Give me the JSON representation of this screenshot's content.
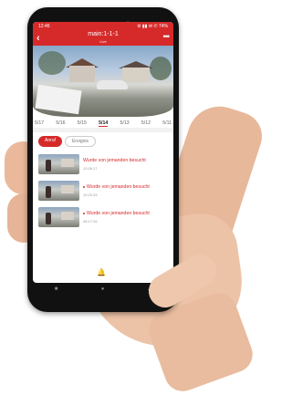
{
  "status_bar": {
    "time": "12:46",
    "icons": "⚙ ▮▮ ✉ ✆ 74%"
  },
  "app_bar": {
    "title": "main:1-1-1",
    "subtitle": "Live"
  },
  "dates": [
    "5/17",
    "5/16",
    "5/15",
    "5/14",
    "5/13",
    "5/12",
    "5/11"
  ],
  "active_date": "5/14",
  "tabs": {
    "call": "Anruf",
    "event": "Ereignis"
  },
  "events": [
    {
      "text": "Wurde von jemanden besucht",
      "time": "12:06:17"
    },
    {
      "text": "Wurde von jemanden besucht",
      "time": "10:20:33"
    },
    {
      "text": "Wurde von jemanden besucht",
      "time": "08:17:26"
    }
  ],
  "colors": {
    "accent": "#d62a2a"
  }
}
